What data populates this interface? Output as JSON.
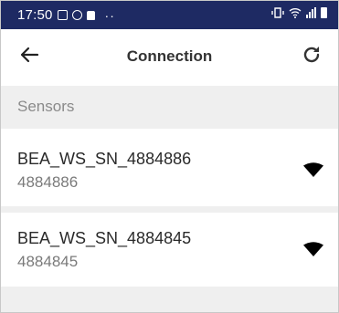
{
  "status_bar": {
    "time": "17:50",
    "dots": "··",
    "bg_color": "#1e2a63"
  },
  "app_bar": {
    "title": "Connection",
    "back_icon": "arrow-left",
    "refresh_icon": "refresh"
  },
  "section": {
    "label": "Sensors"
  },
  "sensors": [
    {
      "name": "BEA_WS_SN_4884886",
      "id": "4884886",
      "icon": "wifi-signal"
    },
    {
      "name": "BEA_WS_SN_4884845",
      "id": "4884845",
      "icon": "wifi-signal"
    }
  ]
}
